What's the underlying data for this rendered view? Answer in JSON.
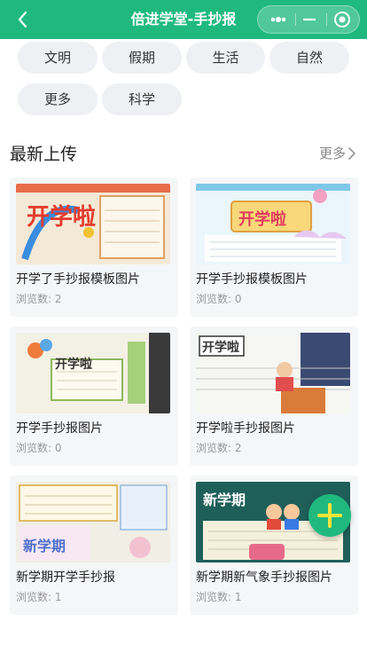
{
  "header": {
    "title": "倍进学堂-手抄报"
  },
  "tags": [
    "文明",
    "假期",
    "生活",
    "自然",
    "更多",
    "科学"
  ],
  "section": {
    "title": "最新上传",
    "more_label": "更多"
  },
  "cards": [
    {
      "title": "开学了手抄报模板图片",
      "views": "浏览数: 2",
      "thumb_text": "开学啦"
    },
    {
      "title": "开学手抄报模板图片",
      "views": "浏览数: 0",
      "thumb_text": "开学啦"
    },
    {
      "title": "开学手抄报图片",
      "views": "浏览数: 0",
      "thumb_text": "开学啦"
    },
    {
      "title": "开学啦手抄报图片",
      "views": "浏览数: 2",
      "thumb_text": "开学啦"
    },
    {
      "title": "新学期开学手抄报",
      "views": "浏览数: 1",
      "thumb_text": "新学期"
    },
    {
      "title": "新学期新气象手抄报图片",
      "views": "浏览数: 1",
      "thumb_text": "新学期"
    }
  ],
  "colors": {
    "brand": "#1fb97f",
    "tag_bg": "#eef0f4",
    "card_bg": "#f5f6f8"
  },
  "icons": {
    "back": "chevron-left-icon",
    "more_chevron": "chevron-right-icon",
    "fab": "plus-icon"
  }
}
